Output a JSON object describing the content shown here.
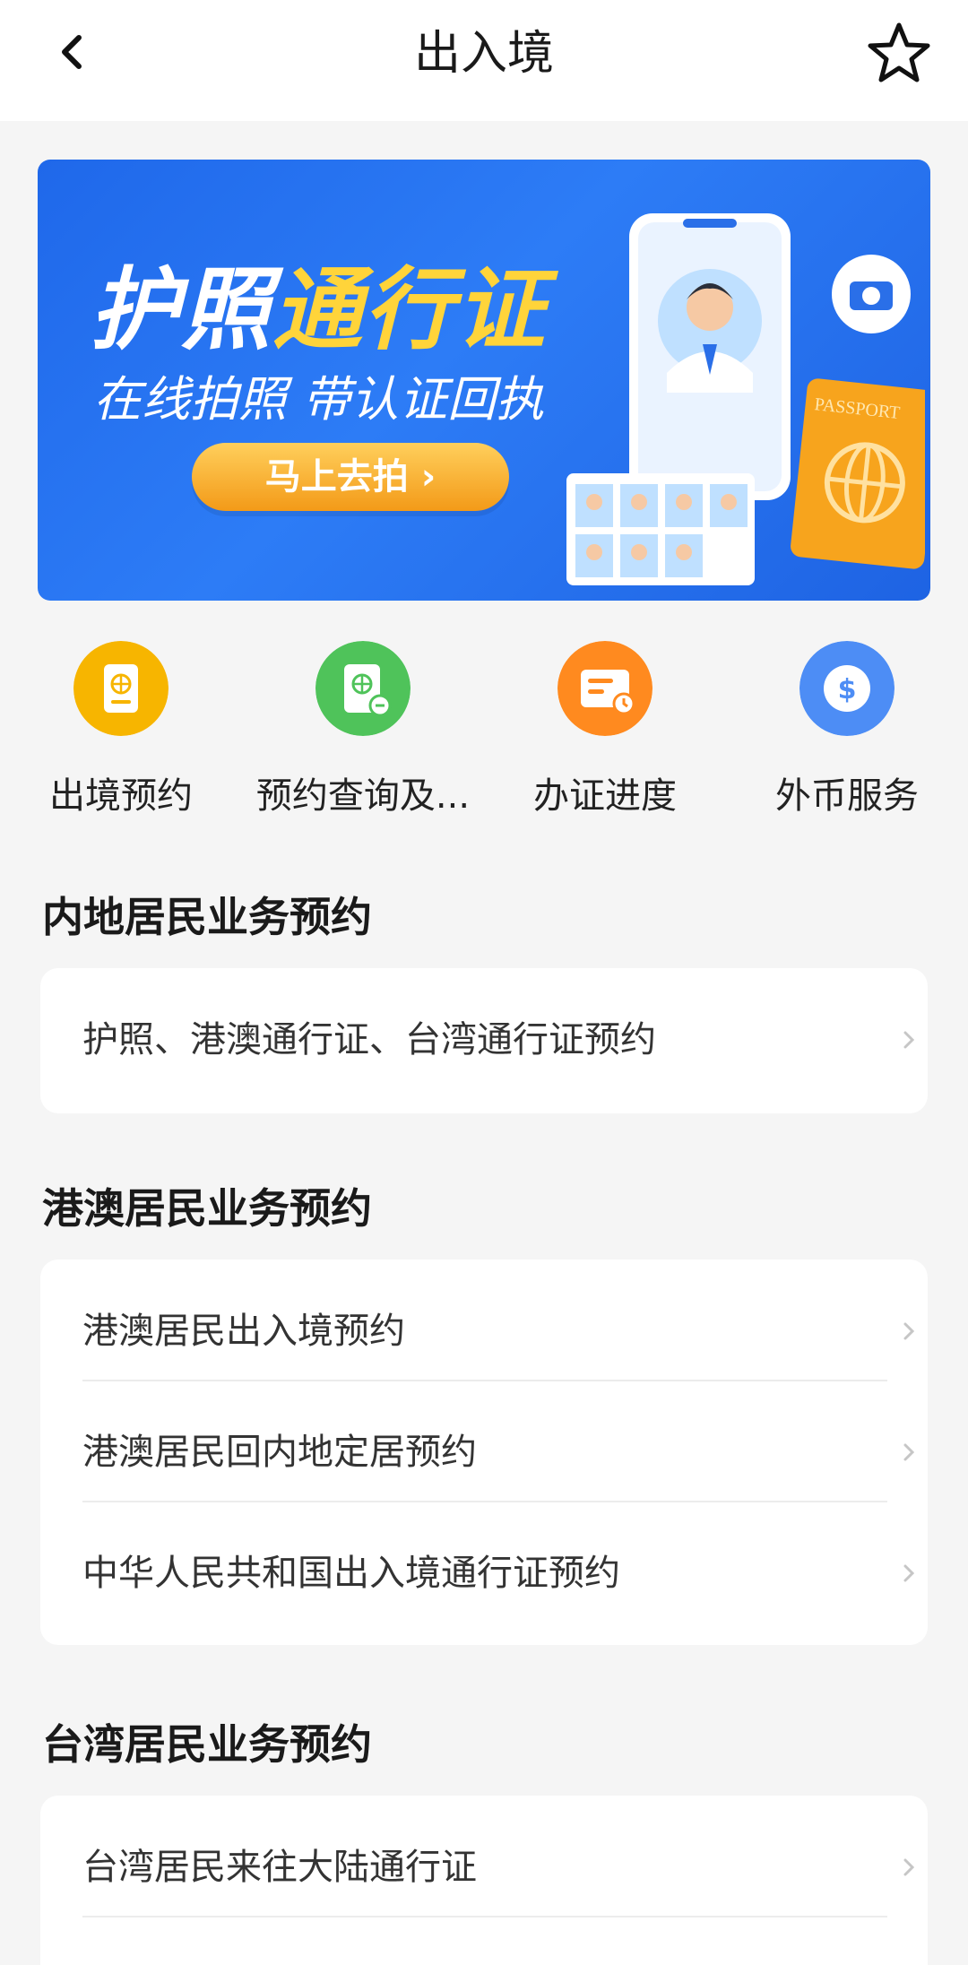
{
  "header": {
    "title": "出入境"
  },
  "banner": {
    "title_part1": "护照",
    "title_part2": "通行证",
    "subtitle": "在线拍照 带认证回执",
    "button_label": "马上去拍 ›",
    "passport_text": "PASSPORT"
  },
  "quick_actions": [
    {
      "label": "出境预约",
      "icon": "passport-icon",
      "color": "#f7b500"
    },
    {
      "label": "预约查询及...",
      "icon": "document-search-icon",
      "color": "#4fc35a"
    },
    {
      "label": "办证进度",
      "icon": "progress-card-icon",
      "color": "#ff8a1f"
    },
    {
      "label": "外币服务",
      "icon": "dollar-icon",
      "color": "#4d8df5"
    }
  ],
  "sections": [
    {
      "title": "内地居民业务预约",
      "items": [
        "护照、港澳通行证、台湾通行证预约"
      ]
    },
    {
      "title": "港澳居民业务预约",
      "items": [
        "港澳居民出入境预约",
        "港澳居民回内地定居预约",
        "中华人民共和国出入境通行证预约"
      ]
    },
    {
      "title": "台湾居民业务预约",
      "items": [
        "台湾居民来往大陆通行证"
      ]
    }
  ]
}
